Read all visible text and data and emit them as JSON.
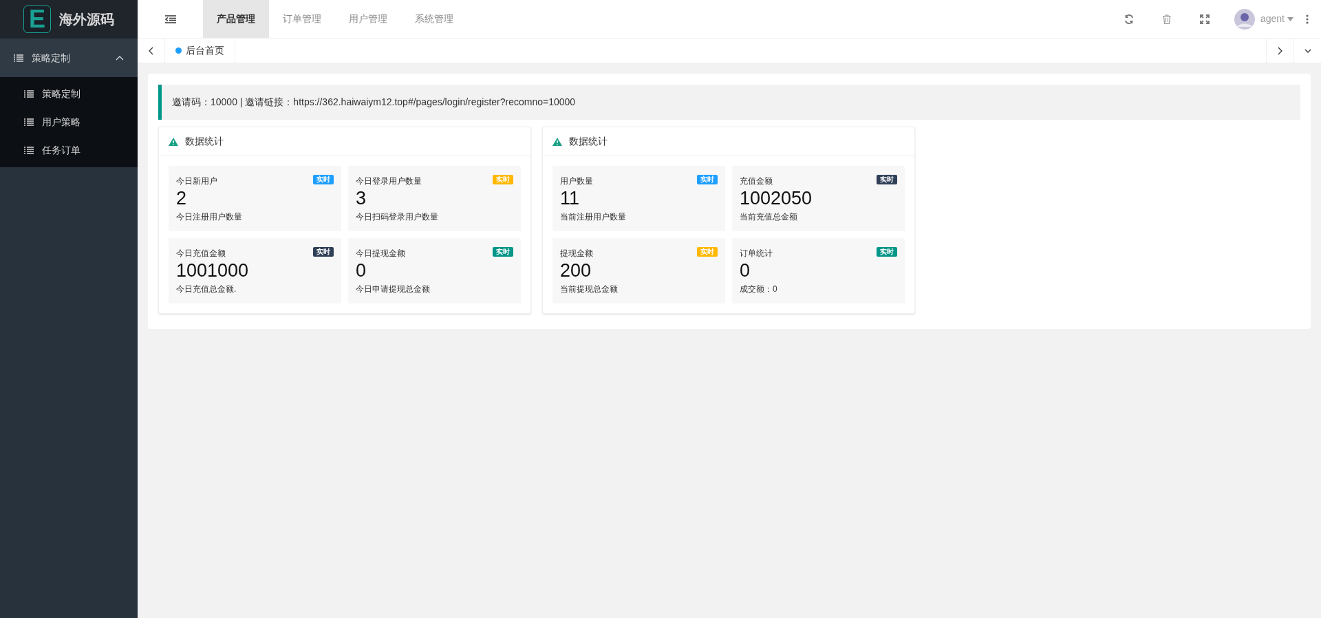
{
  "logo": {
    "letter": "E",
    "title": "海外源码"
  },
  "sidebar": {
    "items": [
      {
        "label": "策略定制",
        "expanded": true,
        "children": [
          {
            "label": "策略定制",
            "selected": false
          },
          {
            "label": "用户策略",
            "selected": false
          },
          {
            "label": "任务订单",
            "selected": false
          }
        ]
      }
    ]
  },
  "top_tabs": [
    {
      "label": "产品管理",
      "selected": true
    },
    {
      "label": "订单管理",
      "selected": false
    },
    {
      "label": "用户管理",
      "selected": false
    },
    {
      "label": "系统管理",
      "selected": false
    }
  ],
  "user": {
    "name": "agent"
  },
  "page_tabs": [
    {
      "label": "后台首页",
      "selected": true
    }
  ],
  "notice": "邀请码：10000 | 邀请链接：https://362.haiwaiym12.top#/pages/login/register?recomno=10000",
  "panels": [
    {
      "title": "数据统计",
      "stats": [
        {
          "label": "今日新用户",
          "badge": "实时",
          "color": "#1e9fff",
          "value": "2",
          "note": "今日注册用户数量"
        },
        {
          "label": "今日登录用户数量",
          "badge": "实时",
          "color": "#ffb800",
          "value": "3",
          "note": "今日扫码登录用户数量"
        },
        {
          "label": "今日充值金额",
          "badge": "实时",
          "color": "#2f4056",
          "value": "1001000",
          "note": "今日充值总金额."
        },
        {
          "label": "今日提现金额",
          "badge": "实时",
          "color": "#009688",
          "value": "0",
          "note": "今日申请提现总金额"
        }
      ]
    },
    {
      "title": "数据统计",
      "stats": [
        {
          "label": "用户数量",
          "badge": "实时",
          "color": "#1e9fff",
          "value": "11",
          "note": "当前注册用户数量"
        },
        {
          "label": "充值金额",
          "badge": "实时",
          "color": "#2f4056",
          "value": "1002050",
          "note": "当前充值总金额"
        },
        {
          "label": "提现金额",
          "badge": "实时",
          "color": "#ffb800",
          "value": "200",
          "note": "当前提现总金额"
        },
        {
          "label": "订单统计",
          "badge": "实时",
          "color": "#009688",
          "value": "0",
          "note": "成交额：0"
        }
      ]
    }
  ]
}
